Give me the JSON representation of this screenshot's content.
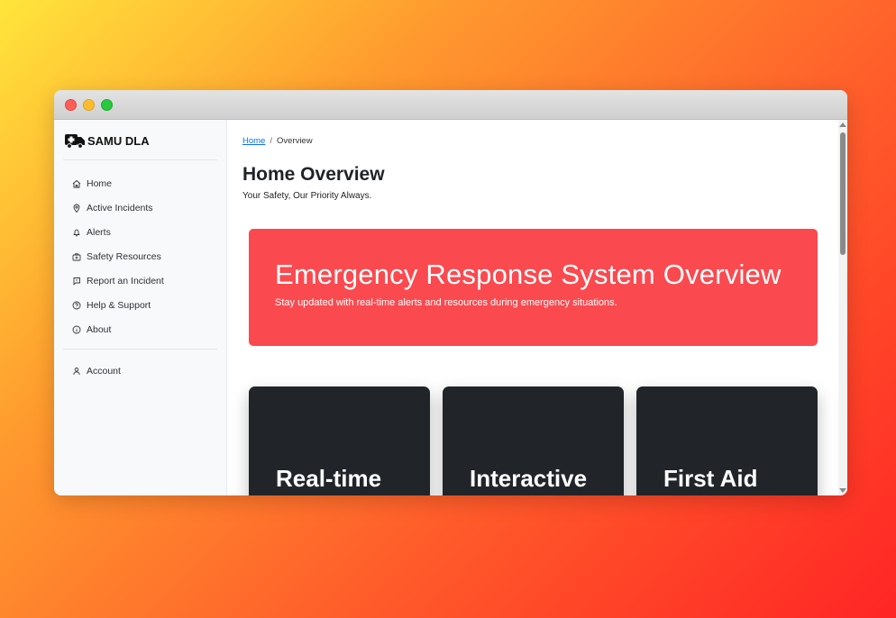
{
  "app": {
    "brand": "SAMU DLA",
    "brand_icon": "ambulance-icon"
  },
  "sidebar": {
    "items": [
      {
        "label": "Home",
        "icon": "home-icon"
      },
      {
        "label": "Active Incidents",
        "icon": "map-pin-icon"
      },
      {
        "label": "Alerts",
        "icon": "bell-icon"
      },
      {
        "label": "Safety Resources",
        "icon": "first-aid-kit-icon"
      },
      {
        "label": "Report an Incident",
        "icon": "report-flag-icon"
      },
      {
        "label": "Help & Support",
        "icon": "help-circle-icon"
      },
      {
        "label": "About",
        "icon": "info-circle-icon"
      }
    ],
    "account": {
      "label": "Account",
      "icon": "user-icon"
    }
  },
  "breadcrumb": {
    "home": "Home",
    "separator": "/",
    "current": "Overview"
  },
  "page": {
    "title": "Home Overview",
    "subtitle": "Your Safety, Our Priority Always."
  },
  "hero": {
    "title": "Emergency Response System Overview",
    "subtitle": "Stay updated with real-time alerts and resources during emergency situations.",
    "color": "#fa4a4f"
  },
  "cards": [
    {
      "title": "Real-time"
    },
    {
      "title": "Interactive"
    },
    {
      "title": "First Aid"
    }
  ],
  "colors": {
    "card_bg": "#212529",
    "link": "#0d6efd"
  }
}
